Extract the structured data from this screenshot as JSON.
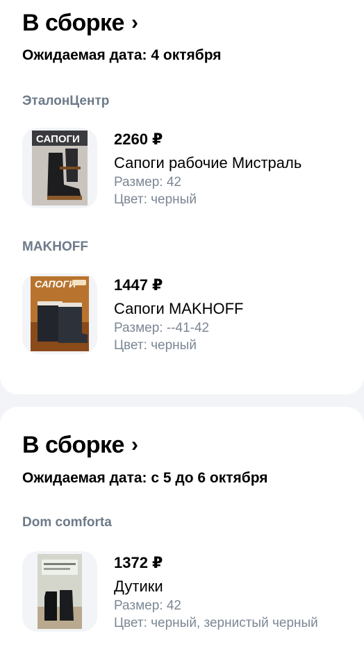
{
  "groups": [
    {
      "title": "В сборке",
      "expected": "Ожидаемая дата: 4 октября",
      "sellers": [
        {
          "name": "ЭталонЦентр",
          "item": {
            "price": "2260 ₽",
            "name": "Сапоги рабочие Мистраль",
            "size": "Размер: 42",
            "color": "Цвет: черный",
            "badge": "САПОГИ"
          }
        },
        {
          "name": "MAKHOFF",
          "item": {
            "price": "1447 ₽",
            "name": "Сапоги MAKHOFF",
            "size": "Размер: --41-42",
            "color": "Цвет: черный",
            "badge": "САПОГИ"
          }
        }
      ]
    },
    {
      "title": "В сборке",
      "expected": "Ожидаемая дата: с 5 до 6 октября",
      "sellers": [
        {
          "name": "Dom comforta",
          "item": {
            "price": "1372 ₽",
            "name": "Дутики",
            "size": "Размер: 42",
            "color": "Цвет: черный, зернистый черный"
          }
        }
      ]
    }
  ],
  "icons": {
    "chevron": "chevron-right-icon"
  }
}
